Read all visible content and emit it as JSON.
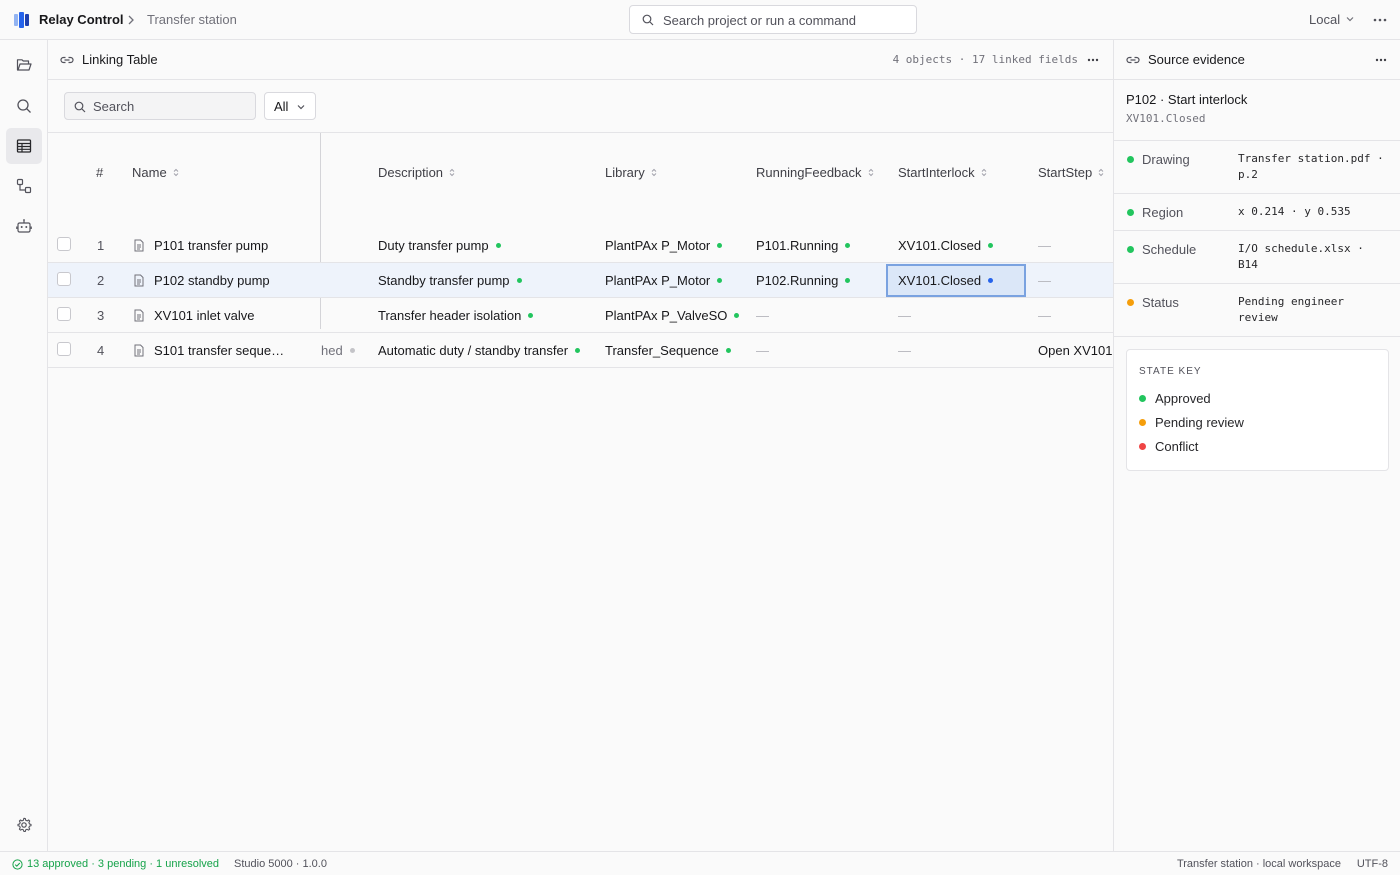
{
  "app": {
    "name": "Relay Control",
    "breadcrumb": "Transfer station"
  },
  "command": {
    "placeholder": "Search project or run a command"
  },
  "environment": {
    "label": "Local"
  },
  "rail": {
    "items": [
      "folder-icon",
      "search-icon",
      "table-icon",
      "graph-icon",
      "robot-icon"
    ],
    "active": "table-icon",
    "bottom": "settings-icon"
  },
  "linking": {
    "title": "Linking Table",
    "meta": "4 objects · 17 linked fields",
    "search_placeholder": "Search",
    "filter_value": "All",
    "columns": {
      "num": "#",
      "name": "Name",
      "description": "Description",
      "library": "Library",
      "running": "RunningFeedback",
      "interlock": "StartInterlock",
      "step": "StartStep"
    },
    "rows": [
      {
        "num": "1",
        "name": "P101 transfer pump",
        "partial": "",
        "description": "Duty transfer pump",
        "library": "PlantPAx P_Motor",
        "running": "P101.Running",
        "interlock": "XV101.Closed",
        "step": "—"
      },
      {
        "num": "2",
        "name": "P102 standby pump",
        "partial": "",
        "description": "Standby transfer pump",
        "library": "PlantPAx P_Motor",
        "running": "P102.Running",
        "interlock": "XV101.Closed",
        "step": "—"
      },
      {
        "num": "3",
        "name": "XV101 inlet valve",
        "partial": "",
        "description": "Transfer header isolation",
        "library": "PlantPAx P_ValveSO",
        "running": "—",
        "interlock": "—",
        "step": "—"
      },
      {
        "num": "4",
        "name": "S101 transfer seque…",
        "partial": "hed",
        "description": "Automatic duty / standby transfer",
        "library": "Transfer_Sequence",
        "running": "—",
        "interlock": "—",
        "step": "Open XV101"
      }
    ],
    "selected_row": 1
  },
  "evidence": {
    "title": "Source evidence",
    "subject": "P102 · Start interlock",
    "tag": "XV101.Closed",
    "rows": [
      {
        "key": "Drawing",
        "value": "Transfer station.pdf · p.2",
        "state": "approved"
      },
      {
        "key": "Region",
        "value": "x 0.214 · y 0.535",
        "state": "approved"
      },
      {
        "key": "Schedule",
        "value": "I/O schedule.xlsx · B14",
        "state": "approved"
      },
      {
        "key": "Status",
        "value": "Pending engineer review",
        "state": "pending"
      }
    ],
    "state_key": {
      "title": "STATE KEY",
      "items": [
        {
          "label": "Approved",
          "color": "#22c55e"
        },
        {
          "label": "Pending review",
          "color": "#f59e0b"
        },
        {
          "label": "Conflict",
          "color": "#ef4444"
        }
      ]
    }
  },
  "colors": {
    "approved": "#22c55e",
    "pending": "#f59e0b",
    "conflict": "#ef4444",
    "selected": "#2563eb",
    "neutral": "#c4c4c8",
    "brand": "#2563eb"
  },
  "status": {
    "summary": "13 approved · 3 pending · 1 unresolved",
    "version": "Studio 5000 · 1.0.0",
    "workspace": "Transfer station · local workspace",
    "encoding": "UTF-8"
  }
}
